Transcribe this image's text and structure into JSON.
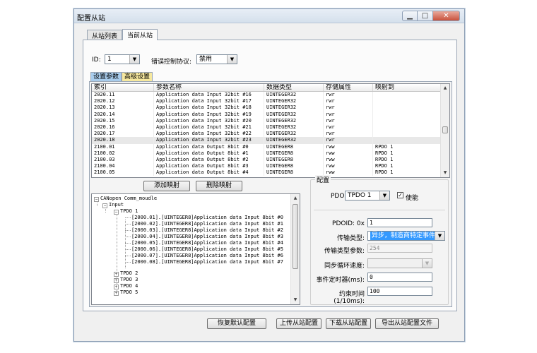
{
  "window": {
    "title": "配置从站"
  },
  "tabs": [
    {
      "label": "从站列表"
    },
    {
      "label": "当前从站"
    }
  ],
  "top_fields": {
    "id_label": "ID:",
    "id_value": "1",
    "error_label": "错误控制协议:",
    "error_value": "禁用"
  },
  "subtabs": [
    {
      "label": "设置参数"
    },
    {
      "label": "高级设置"
    }
  ],
  "grid": {
    "columns": [
      "索引",
      "参数名称",
      "数据类型",
      "存储属性",
      "映射到"
    ],
    "rows": [
      [
        "2020.11",
        "Application data Input 32bit #16",
        "UINTEGER32",
        "rwr",
        ""
      ],
      [
        "2020.12",
        "Application data Input 32bit #17",
        "UINTEGER32",
        "rwr",
        ""
      ],
      [
        "2020.13",
        "Application data Input 32bit #18",
        "UINTEGER32",
        "rwr",
        ""
      ],
      [
        "2020.14",
        "Application data Input 32bit #19",
        "UINTEGER32",
        "rwr",
        ""
      ],
      [
        "2020.15",
        "Application data Input 32bit #20",
        "UINTEGER32",
        "rwr",
        ""
      ],
      [
        "2020.16",
        "Application data Input 32bit #21",
        "UINTEGER32",
        "rwr",
        ""
      ],
      [
        "2020.17",
        "Application data Input 32bit #22",
        "UINTEGER32",
        "rwr",
        ""
      ],
      [
        "2020.18",
        "Application data Input 32bit #23",
        "UINTEGER32",
        "rwr",
        ""
      ],
      [
        "2100.01",
        "Application data Output 8bit #0",
        "UINTEGER8",
        "rww",
        "RPDO 1"
      ],
      [
        "2100.02",
        "Application data Output 8bit #1",
        "UINTEGER8",
        "rww",
        "RPDO 1"
      ],
      [
        "2100.03",
        "Application data Output 8bit #2",
        "UINTEGER8",
        "rww",
        "RPDO 1"
      ],
      [
        "2100.04",
        "Application data Output 8bit #3",
        "UINTEGER8",
        "rww",
        "RPDO 1"
      ],
      [
        "2100.05",
        "Application data Output 8bit #4",
        "UINTEGER8",
        "rww",
        "RPDO 1"
      ]
    ]
  },
  "buttons": {
    "add_mapping": "添加映射",
    "delete_mapping": "删除映射",
    "restore_default": "恢复默认配置",
    "upload": "上传从站配置",
    "download": "下载从站配置",
    "export": "导出从站配置文件"
  },
  "tree": {
    "root": "CANopen Comm_moudle",
    "input": "Input",
    "tpdo1": "TPDO 1",
    "entries": [
      "[2000.01].[UINTEGER8]Application data Input 8bit #0",
      "[2000.02].[UINTEGER8]Application data Input 8bit #1",
      "[2000.03].[UINTEGER8]Application data Input 8bit #2",
      "[2000.04].[UINTEGER8]Application data Input 8bit #3",
      "[2000.05].[UINTEGER8]Application data Input 8bit #4",
      "[2000.06].[UINTEGER8]Application data Input 8bit #5",
      "[2000.07].[UINTEGER8]Application data Input 8bit #6",
      "[2000.08].[UINTEGER8]Application data Input 8bit #7"
    ],
    "tpdo_more": [
      "TPDO 2",
      "TPDO 3",
      "TPDO 4",
      "TPDO 5"
    ]
  },
  "config": {
    "group_label": "配置",
    "pdo_label": "PDO:",
    "pdo_value": "TPDO 1",
    "enable_label": "使能",
    "enable_check": "✓",
    "pdoid_label": "PDOID: 0x",
    "pdoid_value": "1",
    "transfer_type_label": "传输类型:",
    "transfer_type_value": "异步，制造商特定事件",
    "transfer_param_label": "传输类型参数:",
    "transfer_param_value": "254",
    "sync_speed_label": "同步循环速度:",
    "sync_speed_value": "",
    "event_timer_label": "事件定时器(ms):",
    "event_timer_value": "0",
    "inhibit_label": "约束时间(1/10ms):",
    "inhibit_value": "100"
  },
  "icons": {
    "minimize": "▁",
    "maximize": "□",
    "close": "✕",
    "dropdown": "▼",
    "scroll_up": "▲",
    "scroll_down": "▼",
    "collapse": "−",
    "expand": "+"
  }
}
